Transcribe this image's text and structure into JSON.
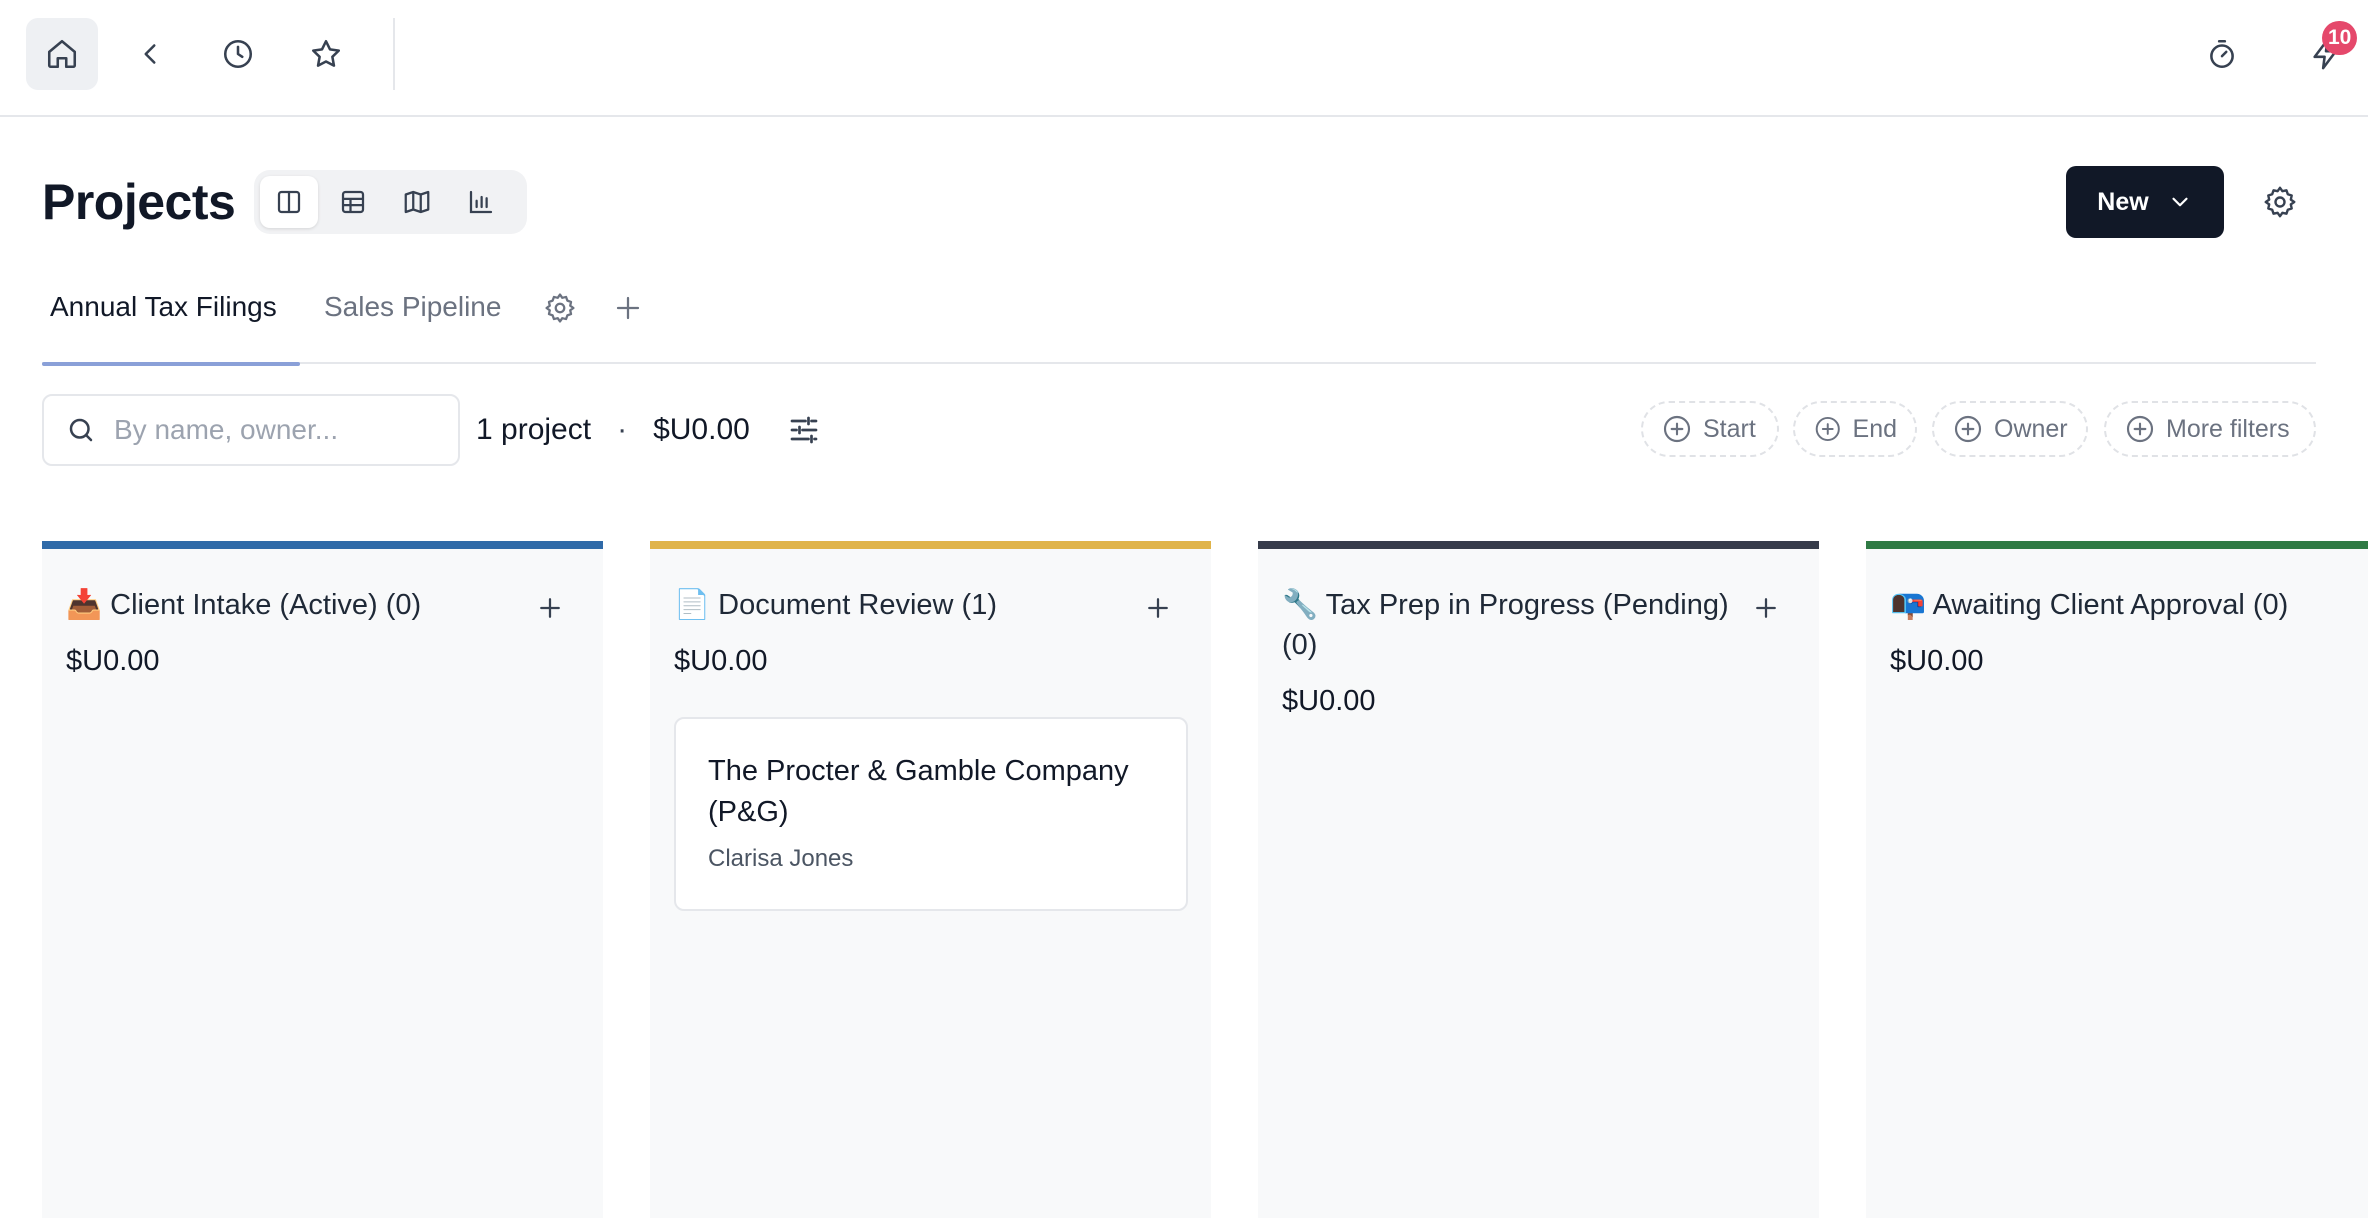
{
  "topbar": {
    "notifications_count": "10"
  },
  "header": {
    "title": "Projects",
    "views": [
      "board-view",
      "table-view",
      "map-view",
      "chart-view"
    ],
    "new_button": "New"
  },
  "tabs": [
    {
      "label": "Annual Tax Filings",
      "active": true
    },
    {
      "label": "Sales Pipeline",
      "active": false
    }
  ],
  "filters": {
    "search_placeholder": "By name, owner...",
    "project_count": "1 project",
    "separator": "·",
    "total_amount": "$U0.00",
    "chips": [
      "Start",
      "End",
      "Owner",
      "More filters"
    ]
  },
  "columns": [
    {
      "title": "📥 Client Intake (Active) (0)",
      "amount": "$U0.00",
      "color": "#2f6aa8",
      "cards": []
    },
    {
      "title": "📄 Document Review (1)",
      "amount": "$U0.00",
      "color": "#e0b44a",
      "cards": [
        {
          "title": "The Procter & Gamble Company (P&G)",
          "owner": "Clarisa Jones"
        }
      ]
    },
    {
      "title": "🔧 Tax Prep in Progress (Pending) (0)",
      "amount": "$U0.00",
      "color": "#363b4a",
      "cards": []
    },
    {
      "title": "📭 Awaiting Client Approval (0)",
      "amount": "$U0.00",
      "color": "#2f7a44",
      "cards": []
    }
  ]
}
